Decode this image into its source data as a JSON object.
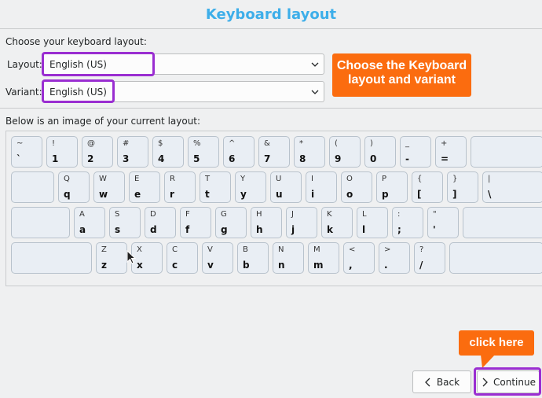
{
  "header": {
    "title": "Keyboard layout"
  },
  "section_label": "Choose your keyboard layout:",
  "layout": {
    "label": "Layout:",
    "value": "English (US)"
  },
  "variant": {
    "label": "Variant:",
    "value": "English (US)"
  },
  "callout_top": {
    "line1": "Choose the Keyboard",
    "line2": "layout and variant"
  },
  "image_label": "Below is an image of your current layout:",
  "keyboard": {
    "row1": [
      {
        "up": "~",
        "lo": "`"
      },
      {
        "up": "!",
        "lo": "1"
      },
      {
        "up": "@",
        "lo": "2"
      },
      {
        "up": "#",
        "lo": "3"
      },
      {
        "up": "$",
        "lo": "4"
      },
      {
        "up": "%",
        "lo": "5"
      },
      {
        "up": "^",
        "lo": "6"
      },
      {
        "up": "&",
        "lo": "7"
      },
      {
        "up": "*",
        "lo": "8"
      },
      {
        "up": "(",
        "lo": "9"
      },
      {
        "up": ")",
        "lo": "0"
      },
      {
        "up": "_",
        "lo": "-"
      },
      {
        "up": "+",
        "lo": "="
      },
      {
        "up": "",
        "lo": ""
      }
    ],
    "row2": [
      {
        "up": "",
        "lo": ""
      },
      {
        "up": "Q",
        "lo": "q"
      },
      {
        "up": "W",
        "lo": "w"
      },
      {
        "up": "E",
        "lo": "e"
      },
      {
        "up": "R",
        "lo": "r"
      },
      {
        "up": "T",
        "lo": "t"
      },
      {
        "up": "Y",
        "lo": "y"
      },
      {
        "up": "U",
        "lo": "u"
      },
      {
        "up": "I",
        "lo": "i"
      },
      {
        "up": "O",
        "lo": "o"
      },
      {
        "up": "P",
        "lo": "p"
      },
      {
        "up": "{",
        "lo": "["
      },
      {
        "up": "}",
        "lo": "]"
      },
      {
        "up": "|",
        "lo": "\\"
      }
    ],
    "row3": [
      {
        "up": "",
        "lo": ""
      },
      {
        "up": "A",
        "lo": "a"
      },
      {
        "up": "S",
        "lo": "s"
      },
      {
        "up": "D",
        "lo": "d"
      },
      {
        "up": "F",
        "lo": "f"
      },
      {
        "up": "G",
        "lo": "g"
      },
      {
        "up": "H",
        "lo": "h"
      },
      {
        "up": "J",
        "lo": "j"
      },
      {
        "up": "K",
        "lo": "k"
      },
      {
        "up": "L",
        "lo": "l"
      },
      {
        "up": ":",
        "lo": ";"
      },
      {
        "up": "\"",
        "lo": "'"
      },
      {
        "up": "",
        "lo": ""
      }
    ],
    "row4": [
      {
        "up": "",
        "lo": ""
      },
      {
        "up": "Z",
        "lo": "z"
      },
      {
        "up": "X",
        "lo": "x"
      },
      {
        "up": "C",
        "lo": "c"
      },
      {
        "up": "V",
        "lo": "v"
      },
      {
        "up": "B",
        "lo": "b"
      },
      {
        "up": "N",
        "lo": "n"
      },
      {
        "up": "M",
        "lo": "m"
      },
      {
        "up": "<",
        "lo": ","
      },
      {
        "up": ">",
        "lo": "."
      },
      {
        "up": "?",
        "lo": "/"
      },
      {
        "up": "",
        "lo": ""
      }
    ]
  },
  "callout_bottom": {
    "text": "click here"
  },
  "nav": {
    "back_label": "Back",
    "continue_label": "Continue"
  },
  "colors": {
    "accent": "#3daee9",
    "highlight": "#9a2ed1",
    "callout": "#fb6c0f"
  },
  "icons": {
    "back": "chevron-left-icon",
    "continue": "chevron-right-icon",
    "dropdown": "chevron-down-icon",
    "cursor": "mouse-pointer-icon"
  }
}
